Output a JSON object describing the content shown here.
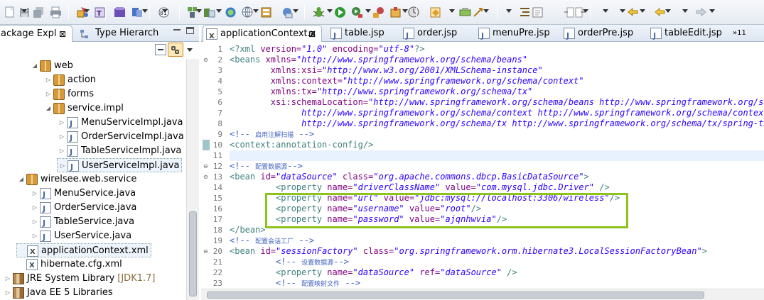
{
  "colors": {
    "highlight_box": "#8dc21f",
    "xml_tag": "#3f7f7f",
    "xml_attr": "#7f007f",
    "xml_value": "#2a00ff",
    "comment": "#3f5fbf"
  },
  "toolbar_icons": [
    "new-file-icon",
    "save-icon",
    "save-all-icon",
    "print-icon",
    "java-project-icon",
    "open-type-icon",
    "build-icon",
    "deploy-icon",
    "package-icon",
    "debug-icon",
    "run-icon",
    "run-external-icon",
    "external-tools-icon",
    "new-java-project-icon",
    "new-class-icon",
    "open-task-icon",
    "search-icon",
    "next-annotation-icon",
    "previous-annotation-icon",
    "last-edit-icon",
    "back-icon",
    "forward-icon"
  ],
  "left": {
    "tabs": [
      {
        "label": "ackage Expl",
        "close": "⊠"
      },
      {
        "label": "Type Hierarch"
      }
    ],
    "tree": [
      {
        "label": "web",
        "depth": 2,
        "twisty": "◢",
        "icon": "pkg"
      },
      {
        "label": "action",
        "depth": 3,
        "twisty": "▷",
        "icon": "pkg"
      },
      {
        "label": "forms",
        "depth": 3,
        "twisty": "▷",
        "icon": "pkg"
      },
      {
        "label": "service.impl",
        "depth": 3,
        "twisty": "◢",
        "icon": "pkg"
      },
      {
        "label": "MenuServiceImpl.java",
        "depth": 4,
        "twisty": "▷",
        "icon": "jfile"
      },
      {
        "label": "OrderServiceImpl.java",
        "depth": 4,
        "twisty": "▷",
        "icon": "jfile"
      },
      {
        "label": "TableServiceImpl.java",
        "depth": 4,
        "twisty": "▷",
        "icon": "jfile"
      },
      {
        "label": "UserServiceImpl.java",
        "depth": 4,
        "twisty": "▷",
        "icon": "jfile",
        "selected": true
      },
      {
        "label": "wirelsee.web.service",
        "depth": 1,
        "twisty": "◢",
        "icon": "pkg"
      },
      {
        "label": "MenuService.java",
        "depth": 2,
        "twisty": "▷",
        "icon": "jfile"
      },
      {
        "label": "OrderService.java",
        "depth": 2,
        "twisty": "▷",
        "icon": "jfile"
      },
      {
        "label": "TableService.java",
        "depth": 2,
        "twisty": "▷",
        "icon": "jfile"
      },
      {
        "label": "UserService.java",
        "depth": 2,
        "twisty": "▷",
        "icon": "jfile"
      },
      {
        "label": "applicationContext.xml",
        "depth": 1,
        "twisty": "",
        "icon": "xfile",
        "selected": true
      },
      {
        "label": "hibernate.cfg.xml",
        "depth": 1,
        "twisty": "",
        "icon": "xfile"
      },
      {
        "label": "JRE System Library",
        "extra": "[JDK1.7]",
        "depth": 0,
        "twisty": "▷",
        "icon": "lib"
      },
      {
        "label": "Java EE 5 Libraries",
        "depth": 0,
        "twisty": "▷",
        "icon": "lib"
      }
    ]
  },
  "editor": {
    "tabs": [
      {
        "label": "applicationContext.x",
        "icon": "xfile",
        "close": "⊠",
        "active": true
      },
      {
        "label": "table.jsp",
        "icon": "jfile"
      },
      {
        "label": "order.jsp",
        "icon": "jfile"
      },
      {
        "label": "menuPre.jsp",
        "icon": "jfile"
      },
      {
        "label": "orderPre.jsp",
        "icon": "jfile"
      },
      {
        "label": "tableEdit.jsp",
        "icon": "jfile"
      }
    ],
    "overflow_label": "»11",
    "lines": [
      {
        "n": "1",
        "segs": [
          [
            "t",
            "<?xml "
          ],
          [
            "a",
            "version="
          ],
          [
            "v",
            "\"1.0\""
          ],
          [
            "a",
            " encoding="
          ],
          [
            "v",
            "\"utf-8\""
          ],
          [
            "t",
            "?>"
          ]
        ]
      },
      {
        "n": "2",
        "fold": "⊖",
        "segs": [
          [
            "t",
            "<beans "
          ],
          [
            "a",
            "xmlns="
          ],
          [
            "v",
            "\"http://www.springframework.org/schema/beans\""
          ]
        ]
      },
      {
        "n": "3",
        "segs": [
          [
            "a",
            "        xmlns:xsi="
          ],
          [
            "v",
            "\"http://www.w3.org/2001/XMLSchema-instance\""
          ]
        ]
      },
      {
        "n": "4",
        "segs": [
          [
            "a",
            "        xmlns:context="
          ],
          [
            "v",
            "\"http://www.springframework.org/schema/context\""
          ]
        ]
      },
      {
        "n": "5",
        "segs": [
          [
            "a",
            "        xmlns:tx="
          ],
          [
            "v",
            "\"http://www.springframework.org/schema/tx\""
          ]
        ]
      },
      {
        "n": "6",
        "segs": [
          [
            "a",
            "        xsi:schemaLocation="
          ],
          [
            "v",
            "\"http://www.springframework.org/schema/beans http://www.springframework.org/schema/beans/spring-beans.xsd"
          ]
        ]
      },
      {
        "n": "7",
        "segs": [
          [
            "v",
            "              http://www.springframework.org/schema/context http://www.springframework.org/schema/context/spring-context.xsd"
          ]
        ]
      },
      {
        "n": "8",
        "segs": [
          [
            "v",
            "              http://www.springframework.org/schema/tx http://www.springframework.org/schema/tx/spring-tx.xsd\""
          ],
          [
            "t",
            ">"
          ]
        ]
      },
      {
        "n": "9",
        "segs": [
          [
            "c",
            "<!-- "
          ],
          [
            "cz",
            "启用注解扫描"
          ],
          [
            "c",
            " -->"
          ]
        ]
      },
      {
        "n": "10",
        "change": true,
        "segs": [
          [
            "t",
            "<context:annotation-config/>"
          ]
        ]
      },
      {
        "n": "11",
        "current": true,
        "segs": []
      },
      {
        "n": "12",
        "fold": "⊖",
        "segs": [
          [
            "c",
            "<!-- "
          ],
          [
            "cz",
            "配置数据源"
          ],
          [
            "c",
            "-->"
          ]
        ]
      },
      {
        "n": "13",
        "fold": "⊖",
        "segs": [
          [
            "t",
            "<bean "
          ],
          [
            "a",
            "id="
          ],
          [
            "v",
            "\"dataSource\""
          ],
          [
            "a",
            " class="
          ],
          [
            "v",
            "\"org.apache.commons.dbcp.BasicDataSource\""
          ],
          [
            "t",
            ">"
          ]
        ]
      },
      {
        "n": "14",
        "segs": [
          [
            "t",
            "         <property "
          ],
          [
            "a",
            "name="
          ],
          [
            "v",
            "\"driverClassName\""
          ],
          [
            "a",
            " value="
          ],
          [
            "v",
            "\"com.mysql.jdbc.Driver\""
          ],
          [
            "t",
            " />"
          ]
        ]
      },
      {
        "n": "15",
        "segs": [
          [
            "t",
            "         <property "
          ],
          [
            "a",
            "name="
          ],
          [
            "v",
            "\"url\""
          ],
          [
            "a",
            " value="
          ],
          [
            "v",
            "\"jdbc:mysql://localhost:3306/wireless\""
          ],
          [
            "t",
            "/>"
          ]
        ]
      },
      {
        "n": "16",
        "segs": [
          [
            "t",
            "         <property "
          ],
          [
            "a",
            "name="
          ],
          [
            "v",
            "\"username\""
          ],
          [
            "a",
            " value="
          ],
          [
            "v",
            "\"root\""
          ],
          [
            "t",
            "/>"
          ]
        ]
      },
      {
        "n": "17",
        "segs": [
          [
            "t",
            "         <property "
          ],
          [
            "a",
            "name="
          ],
          [
            "v",
            "\"password\""
          ],
          [
            "a",
            " value="
          ],
          [
            "v",
            "\"ajqnhwvia\""
          ],
          [
            "t",
            "/>"
          ]
        ]
      },
      {
        "n": "18",
        "segs": [
          [
            "t",
            "</bean>"
          ]
        ]
      },
      {
        "n": "19",
        "segs": [
          [
            "c",
            "<!-- "
          ],
          [
            "cz",
            "配置会话工厂"
          ],
          [
            "c",
            " -->"
          ]
        ]
      },
      {
        "n": "20",
        "fold": "⊖",
        "segs": [
          [
            "t",
            "<bean "
          ],
          [
            "a",
            "id="
          ],
          [
            "v",
            "\"sessionFactory\""
          ],
          [
            "a",
            " class="
          ],
          [
            "v",
            "\"org.springframework.orm.hibernate3.LocalSessionFactoryBean\""
          ],
          [
            "t",
            ">"
          ]
        ]
      },
      {
        "n": "21",
        "segs": [
          [
            "c",
            "         <!-- "
          ],
          [
            "cz",
            "设置数据源"
          ],
          [
            "c",
            "-->"
          ]
        ]
      },
      {
        "n": "22",
        "segs": [
          [
            "t",
            "         <property "
          ],
          [
            "a",
            "name="
          ],
          [
            "v",
            "\"dataSource\""
          ],
          [
            "a",
            " ref="
          ],
          [
            "v",
            "\"dataSource\""
          ],
          [
            "t",
            " />"
          ]
        ]
      },
      {
        "n": "23",
        "segs": [
          [
            "c",
            "         <!-- "
          ],
          [
            "cz",
            "配置映射文件"
          ],
          [
            "c",
            " -->"
          ]
        ]
      }
    ]
  }
}
